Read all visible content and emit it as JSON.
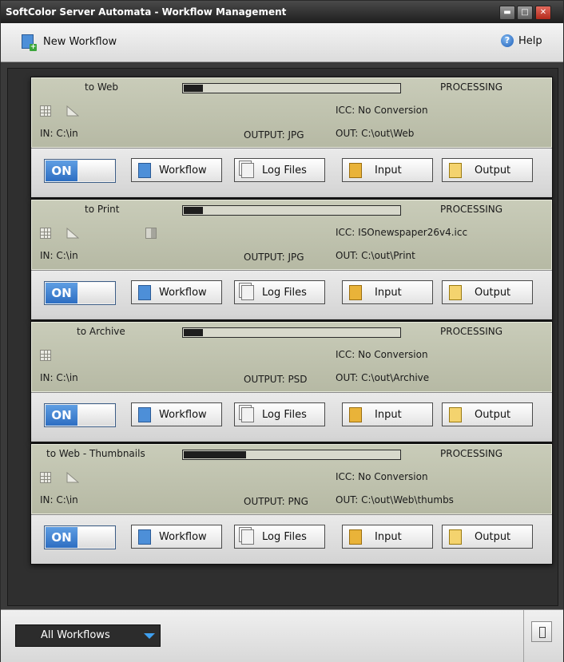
{
  "window": {
    "title": "SoftColor Server Automata - Workflow Management",
    "controls": [
      "minimize-icon",
      "maximize-icon",
      "close-icon"
    ]
  },
  "toolbar": {
    "new_workflow_label": "New Workflow",
    "help_label": "Help"
  },
  "workflows": [
    {
      "name": "to Web",
      "status": "PROCESSING",
      "progress": 0.09,
      "icons": [
        "grid-icon",
        "triangle-icon"
      ],
      "icc": "ICC: No Conversion",
      "input": "IN: C:\\in",
      "output_format": "OUTPUT: JPG",
      "output_path": "OUT: C:\\out\\Web",
      "toggle": "ON"
    },
    {
      "name": "to Print",
      "status": "PROCESSING",
      "progress": 0.09,
      "icons": [
        "grid-icon",
        "triangle-icon",
        "split-icon"
      ],
      "icc": "ICC: ISOnewspaper26v4.icc",
      "input": "IN: C:\\in",
      "output_format": "OUTPUT: JPG",
      "output_path": "OUT: C:\\out\\Print",
      "toggle": "ON"
    },
    {
      "name": "to Archive",
      "status": "PROCESSING",
      "progress": 0.09,
      "icons": [
        "grid-icon"
      ],
      "icc": "ICC: No Conversion",
      "input": "IN: C:\\in",
      "output_format": "OUTPUT: PSD",
      "output_path": "OUT: C:\\out\\Archive",
      "toggle": "ON"
    },
    {
      "name": "to Web - Thumbnails",
      "status": "PROCESSING",
      "progress": 0.29,
      "icons": [
        "grid-icon",
        "triangle-icon"
      ],
      "icc": "ICC: No Conversion",
      "input": "IN: C:\\in",
      "output_format": "OUTPUT: PNG",
      "output_path": "OUT: C:\\out\\Web\\thumbs",
      "toggle": "ON"
    }
  ],
  "buttons": {
    "workflow": "Workflow",
    "log_files": "Log Files",
    "input": "Input",
    "output": "Output"
  },
  "statusbar": {
    "filter_selected": "All Workflows"
  }
}
